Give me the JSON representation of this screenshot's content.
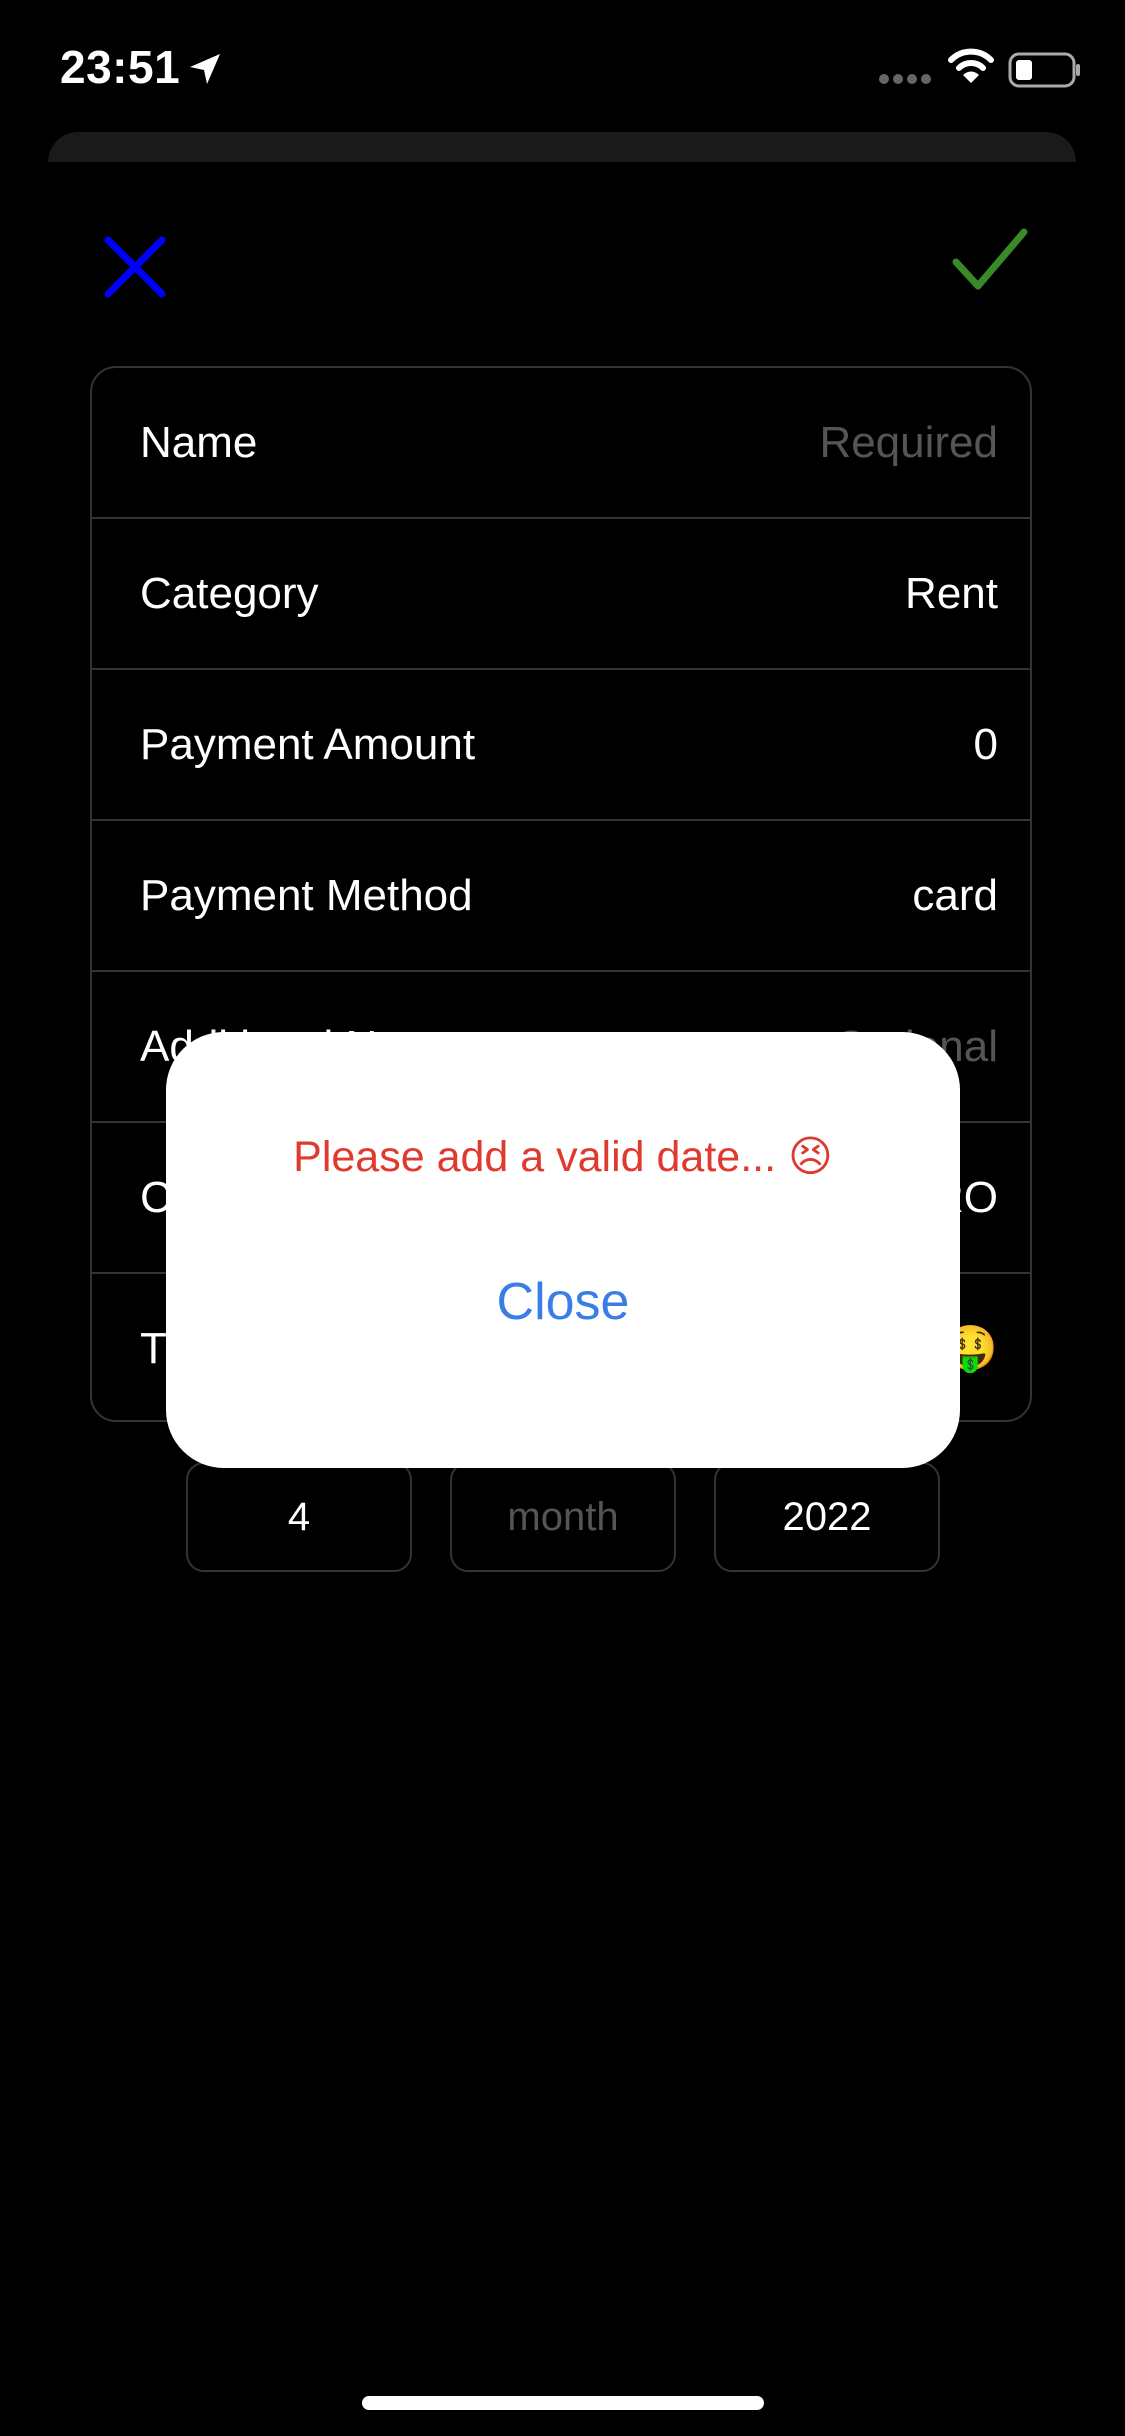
{
  "status_bar": {
    "time": "23:51",
    "icons": [
      "location-arrow-icon",
      "cellular-signal-icon",
      "wifi-icon",
      "battery-icon"
    ]
  },
  "toolbar": {
    "close_icon": "close-x-icon",
    "close_color": "#0000ff",
    "confirm_icon": "checkmark-icon",
    "confirm_color": "#3a8a2a"
  },
  "form": {
    "rows": [
      {
        "label": "Name",
        "value": "Required",
        "is_placeholder": true
      },
      {
        "label": "Category",
        "value": "Rent",
        "is_placeholder": false
      },
      {
        "label": "Payment Amount",
        "value": "0",
        "is_placeholder": false
      },
      {
        "label": "Payment Method",
        "value": "card",
        "is_placeholder": false
      },
      {
        "label": "Additional N",
        "value": "Optional",
        "is_placeholder": true
      },
      {
        "label": "C",
        "value": "RO",
        "is_placeholder": false
      },
      {
        "label": "T",
        "value": "🤑",
        "is_placeholder": false
      }
    ]
  },
  "date": {
    "day": "4",
    "month_placeholder": "month",
    "year": "2022"
  },
  "alert": {
    "message": "Please add a valid date... 😣",
    "message_color": "#e0392e",
    "button_label": "Close",
    "button_color": "#3b7de6"
  }
}
